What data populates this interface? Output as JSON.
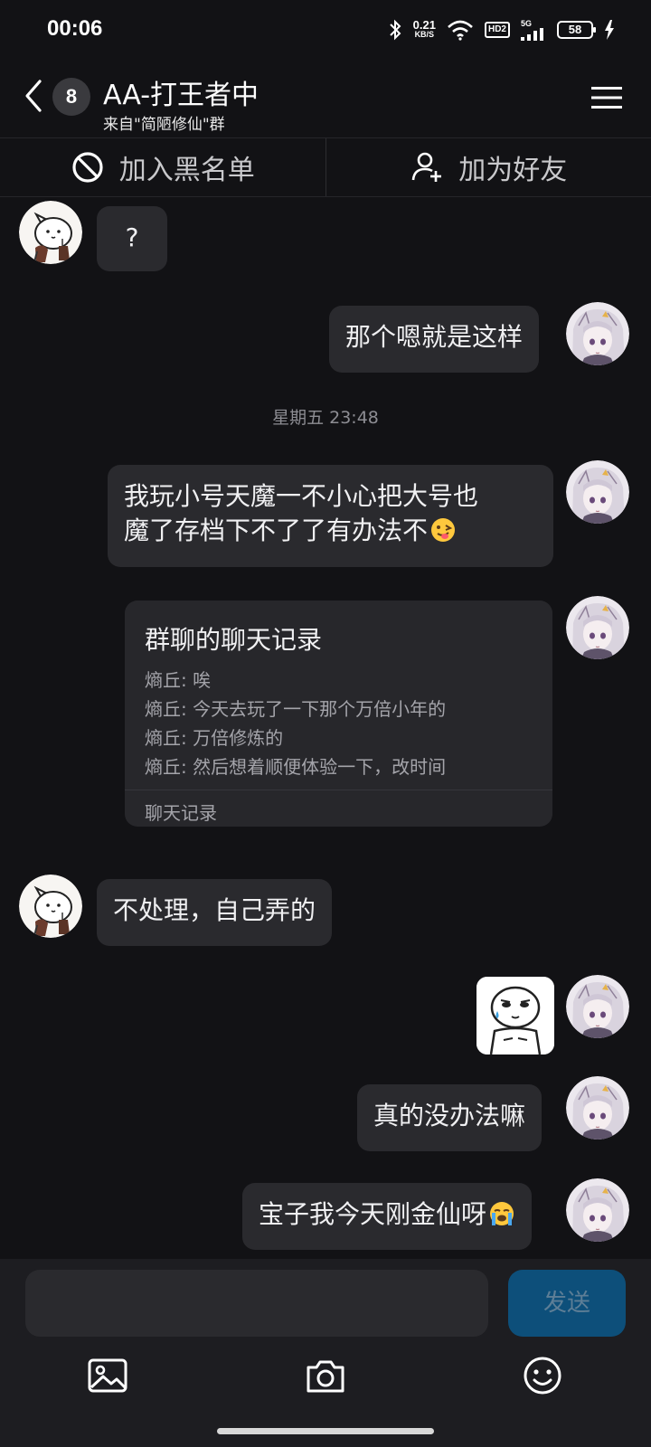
{
  "status_bar": {
    "time": "00:06",
    "net_speed_value": "0.21",
    "net_speed_unit": "KB/S",
    "hd_label": "HD2",
    "signal_label": "5G",
    "battery": "58"
  },
  "header": {
    "unread_count": "8",
    "title": "AA-打王者中",
    "subtitle": "来自\"简陋修仙\"群"
  },
  "actions": {
    "blacklist_label": "加入黑名单",
    "add_friend_label": "加为好友"
  },
  "messages": [
    {
      "side": "left",
      "text": "?"
    },
    {
      "side": "right",
      "text": "那个嗯就是这样"
    },
    {
      "side": "right",
      "text_line1": "我玩小号天魔一不小心把大号也",
      "text_line2": "魔了存档下不了了有办法不"
    },
    {
      "side": "left",
      "text": "不处理，自己弄的"
    },
    {
      "side": "right",
      "text": "真的没办法嘛"
    },
    {
      "side": "right",
      "text": "宝子我今天刚金仙呀"
    }
  ],
  "timestamp": "星期五 23:48",
  "chat_record_card": {
    "title": "群聊的聊天记录",
    "lines": [
      "熵丘: 唉",
      "熵丘: 今天去玩了一下那个万倍小年的",
      "熵丘: 万倍修炼的",
      "熵丘: 然后想着顺便体验一下，改时间"
    ],
    "footer": "聊天记录"
  },
  "composer": {
    "send_label": "发送",
    "input_value": ""
  },
  "icons": {
    "back": "chevron-left-icon",
    "menu": "hamburger-menu-icon",
    "blacklist": "block-icon",
    "add_friend": "add-user-icon",
    "image": "image-icon",
    "camera": "camera-icon",
    "emoji": "smiley-icon"
  },
  "colors": {
    "background": "#121215",
    "bubble": "#2a2a2e",
    "send_button": "#0d4f7a"
  }
}
